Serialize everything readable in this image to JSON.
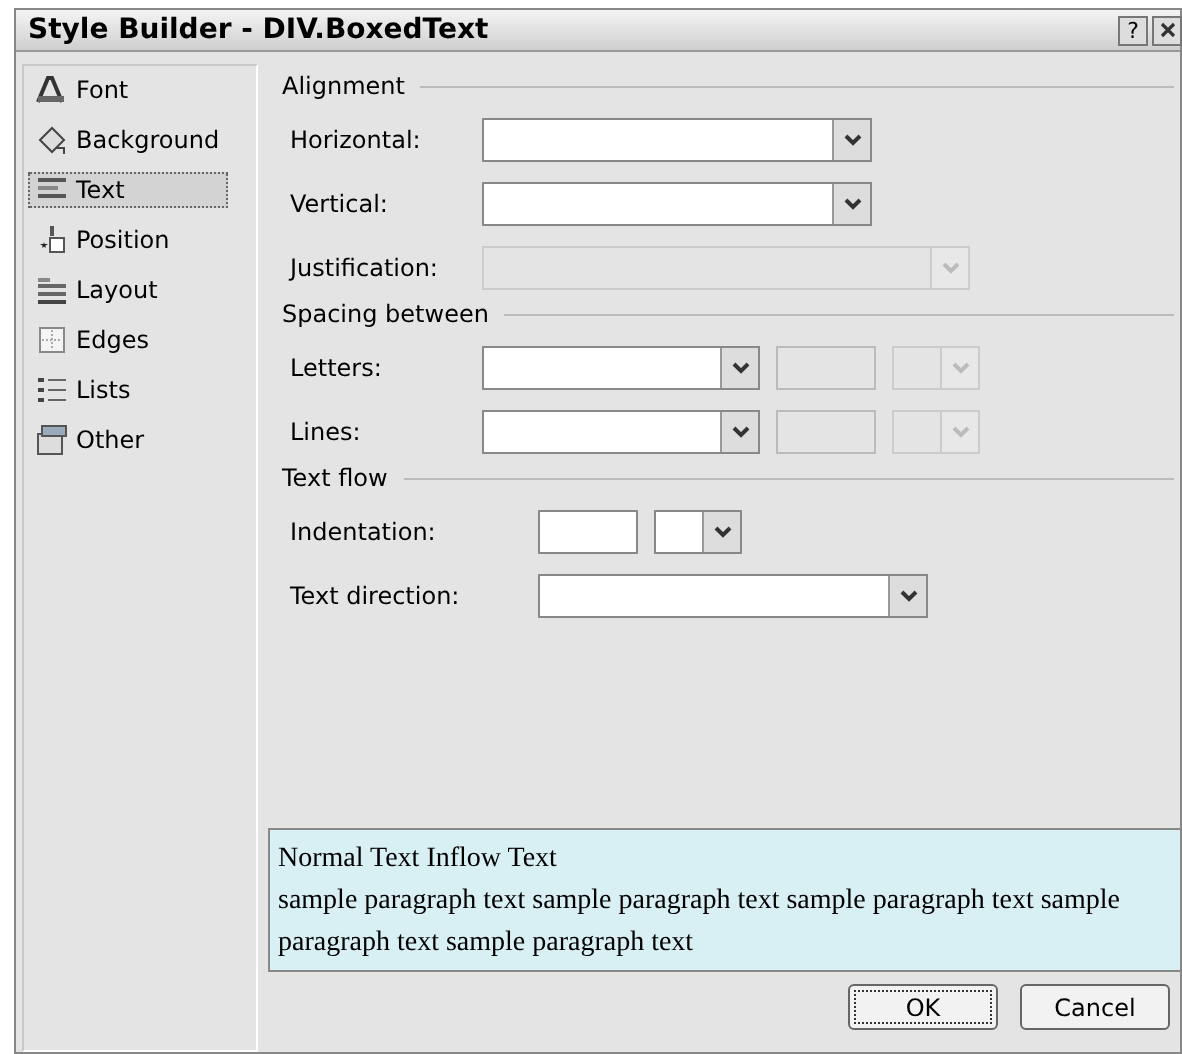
{
  "window": {
    "title": "Style Builder - DIV.BoxedText",
    "help": "?"
  },
  "sidebar": {
    "items": [
      {
        "label": "Font",
        "selected": false
      },
      {
        "label": "Background",
        "selected": false
      },
      {
        "label": "Text",
        "selected": true
      },
      {
        "label": "Position",
        "selected": false
      },
      {
        "label": "Layout",
        "selected": false
      },
      {
        "label": "Edges",
        "selected": false
      },
      {
        "label": "Lists",
        "selected": false
      },
      {
        "label": "Other",
        "selected": false
      }
    ]
  },
  "sections": [
    {
      "title": "Alignment",
      "rows": [
        {
          "label": "Horizontal:",
          "controls": [
            {
              "kind": "combo_long",
              "disabled": false
            }
          ]
        },
        {
          "label": "Vertical:",
          "controls": [
            {
              "kind": "combo_long",
              "disabled": false
            }
          ]
        },
        {
          "label": "Justification:",
          "controls": [
            {
              "kind": "combo_full",
              "disabled": true
            }
          ]
        }
      ]
    },
    {
      "title": "Spacing between",
      "rows": [
        {
          "label": "Letters:",
          "controls": [
            {
              "kind": "combo_medium",
              "disabled": false
            },
            {
              "kind": "box",
              "disabled": true
            },
            {
              "kind": "combo_short",
              "disabled": true
            }
          ]
        },
        {
          "label": "Lines:",
          "controls": [
            {
              "kind": "combo_medium",
              "disabled": false
            },
            {
              "kind": "box",
              "disabled": true
            },
            {
              "kind": "combo_short",
              "disabled": true
            }
          ]
        }
      ]
    },
    {
      "title": "Text flow",
      "rows": [
        {
          "label": "Indentation:",
          "controls": [
            {
              "kind": "box",
              "disabled": false
            },
            {
              "kind": "combo_short",
              "disabled": false
            }
          ]
        },
        {
          "label": "Text direction:",
          "controls": [
            {
              "kind": "combo_direction",
              "disabled": false
            }
          ]
        }
      ]
    }
  ],
  "preview": {
    "heading": "Normal Text Inflow Text",
    "paragraph": "sample paragraph text sample paragraph text sample paragraph text sample paragraph text sample paragraph text"
  },
  "buttons": [
    {
      "label": "OK",
      "focused": true
    },
    {
      "label": "Cancel",
      "focused": false
    }
  ]
}
